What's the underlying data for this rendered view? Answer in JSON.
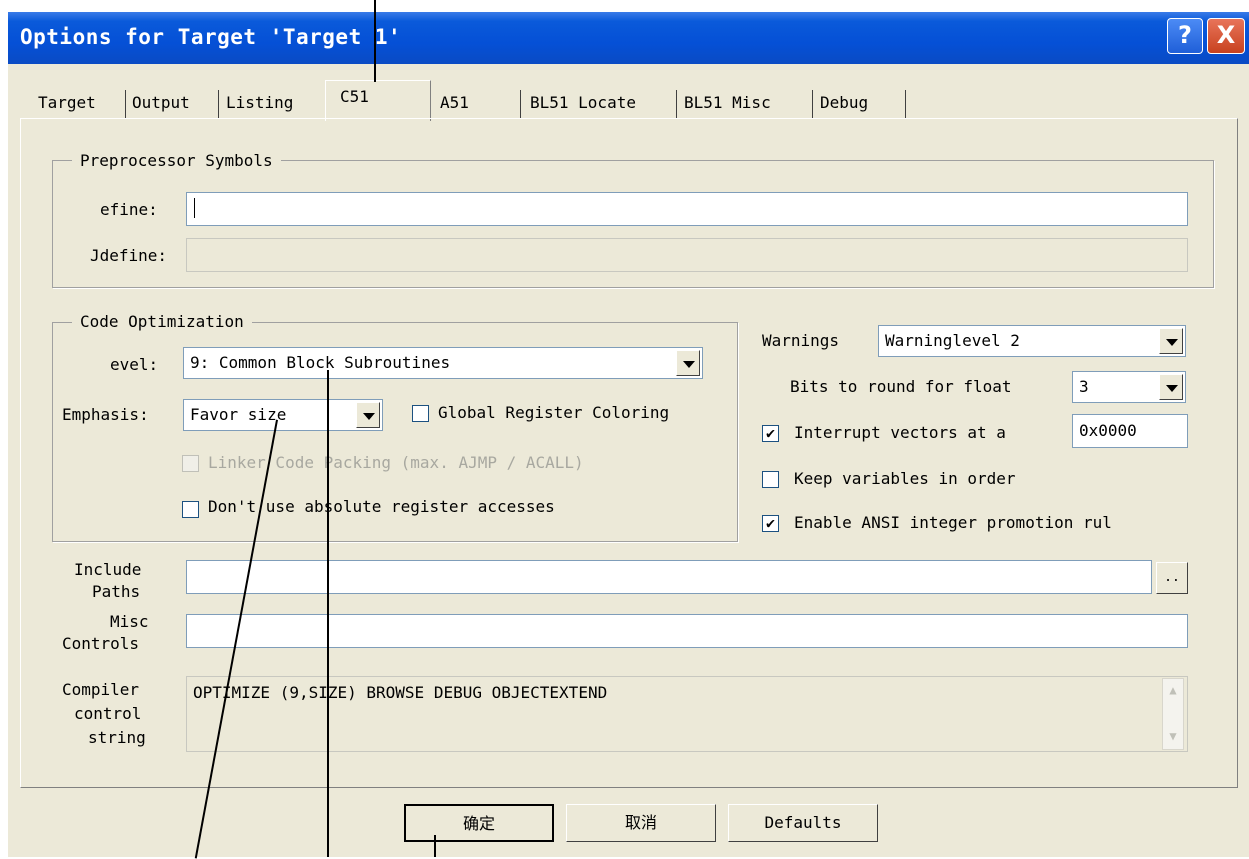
{
  "window": {
    "title": "Options for Target 'Target 1'",
    "help_glyph": "?",
    "close_glyph": "X"
  },
  "tabs": [
    {
      "label": "Target"
    },
    {
      "label": "Output"
    },
    {
      "label": "Listing"
    },
    {
      "label": "C51",
      "active": true
    },
    {
      "label": "A51"
    },
    {
      "label": "BL51 Locate"
    },
    {
      "label": "BL51 Misc"
    },
    {
      "label": "Debug"
    }
  ],
  "preprocessor": {
    "legend": "Preprocessor Symbols",
    "define_label": "efine:",
    "define_value": "",
    "undefine_label": "Jdefine:",
    "undefine_value": ""
  },
  "code_opt": {
    "legend": "Code Optimization",
    "level_label": "evel:",
    "level_value": "9: Common Block Subroutines",
    "emphasis_label": "Emphasis:",
    "emphasis_value": "Favor size",
    "global_reg_label": "Global Register Coloring",
    "global_reg_checked": false,
    "linker_label": "Linker Code Packing (max. AJMP / ACALL)",
    "linker_checked": false,
    "absreg_label": "Don't use absolute register accesses",
    "absreg_checked": false
  },
  "warnings": {
    "label": "Warnings",
    "value": "Warninglevel 2",
    "bits_label": "Bits to round for float",
    "bits_value": "3",
    "interrupt_label": "Interrupt vectors at a",
    "interrupt_checked": true,
    "interrupt_value": "0x0000",
    "keepvars_label": "Keep variables in order",
    "keepvars_checked": false,
    "ansi_label": "Enable ANSI integer promotion rul",
    "ansi_checked": true,
    "check_glyph": "✔"
  },
  "paths": {
    "include_label_1": "Include",
    "include_label_2": "Paths",
    "include_value": "",
    "browse_label": "..",
    "misc_label_1": "Misc",
    "misc_label_2": "Controls",
    "misc_value": "",
    "compiler_label_1": "Compiler",
    "compiler_label_2": "control",
    "compiler_label_3": "string",
    "compiler_value": "OPTIMIZE (9,SIZE) BROWSE DEBUG OBJECTEXTEND"
  },
  "buttons": {
    "ok": "确定",
    "cancel": "取消",
    "defaults": "Defaults"
  }
}
